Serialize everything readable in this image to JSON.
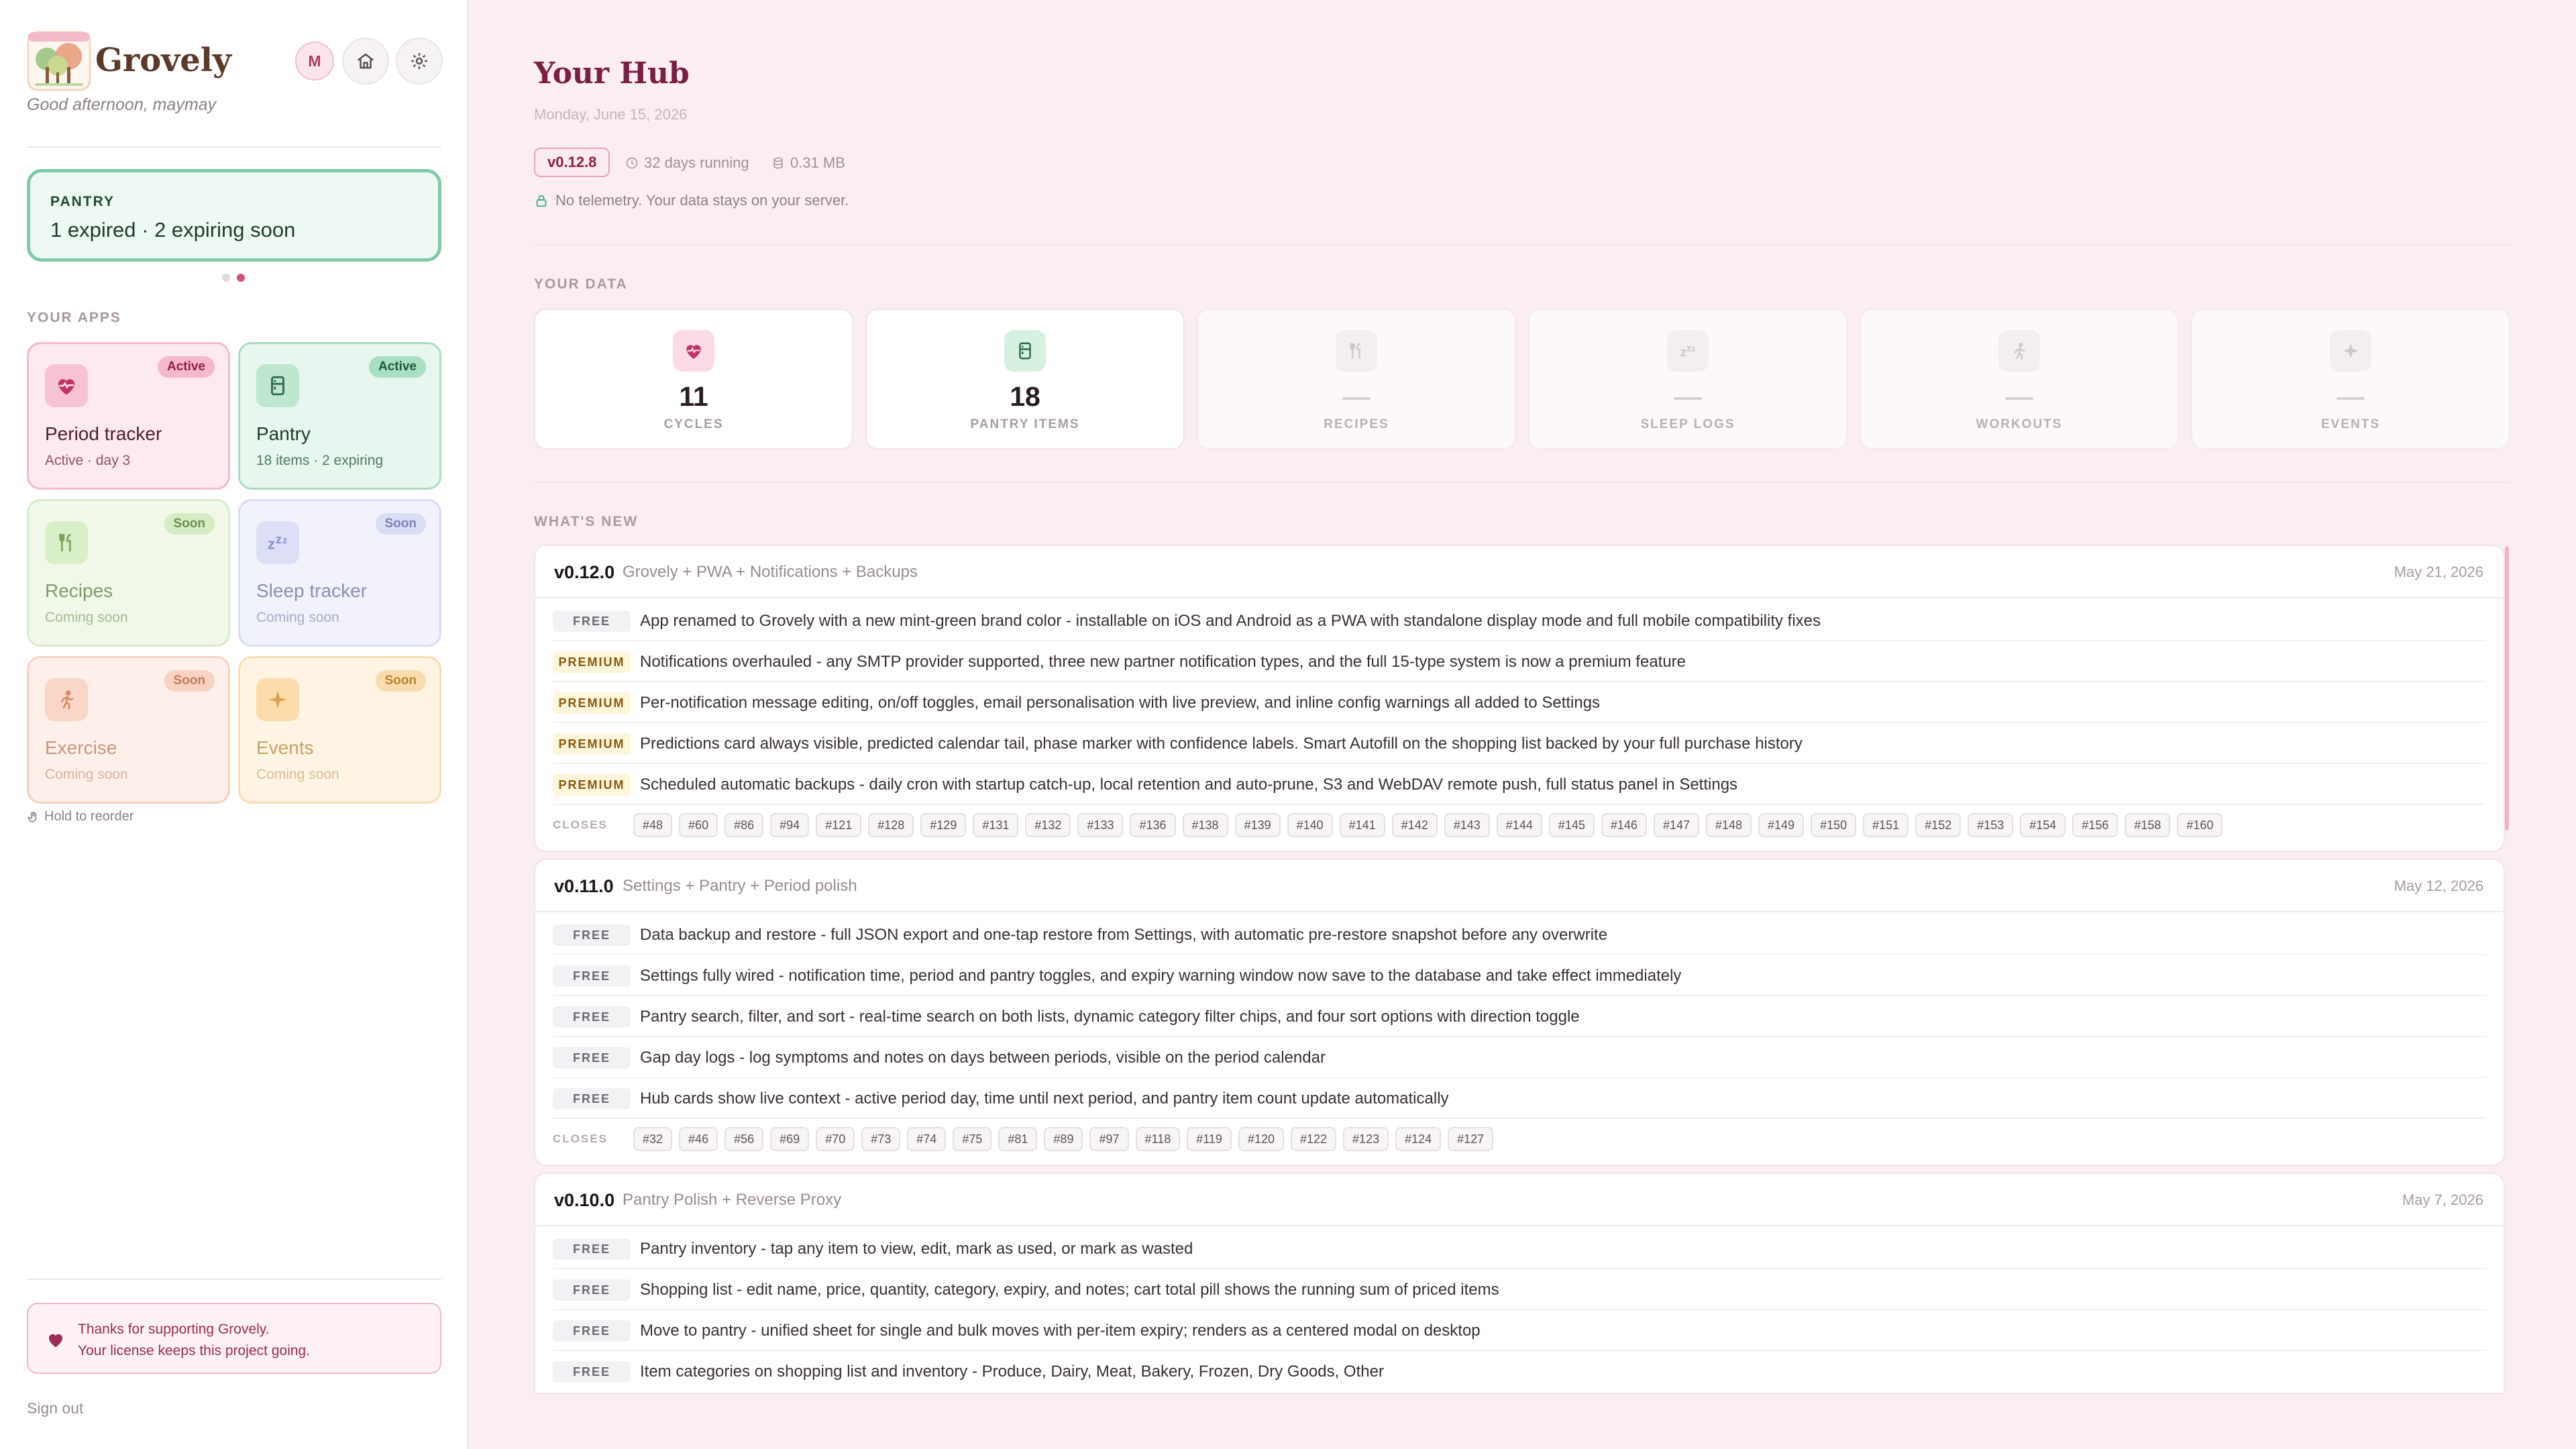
{
  "sidebar": {
    "brand": "Grovely",
    "greeting": "Good afternoon, maymay",
    "avatar_initial": "M",
    "alert": {
      "kicker": "PANTRY",
      "text": "1 expired · 2 expiring soon"
    },
    "apps_label": "YOUR APPS",
    "apps": [
      {
        "name": "Period tracker",
        "sub": "Active · day 3",
        "badge": "Active",
        "icon": "heart-pulse-icon"
      },
      {
        "name": "Pantry",
        "sub": "18 items · 2 expiring",
        "badge": "Active",
        "icon": "fridge-icon"
      },
      {
        "name": "Recipes",
        "sub": "Coming soon",
        "badge": "Soon",
        "icon": "utensils-icon"
      },
      {
        "name": "Sleep tracker",
        "sub": "Coming soon",
        "badge": "Soon",
        "icon": "zzz-icon"
      },
      {
        "name": "Exercise",
        "sub": "Coming soon",
        "badge": "Soon",
        "icon": "running-icon"
      },
      {
        "name": "Events",
        "sub": "Coming soon",
        "badge": "Soon",
        "icon": "sparkle-icon"
      }
    ],
    "hold_hint": "Hold to reorder",
    "thanks_line1": "Thanks for supporting Grovely.",
    "thanks_line2": "Your license keeps this project going.",
    "sign_out": "Sign out"
  },
  "header": {
    "title": "Your Hub",
    "date": "Monday, June 15, 2026",
    "version": "v0.12.8",
    "uptime": "32 days running",
    "size": "0.31 MB",
    "privacy": "No telemetry. Your data stays on your server."
  },
  "your_data": {
    "label": "YOUR DATA",
    "stats": [
      {
        "value": "11",
        "label": "CYCLES"
      },
      {
        "value": "18",
        "label": "PANTRY ITEMS"
      },
      {
        "value": "—",
        "label": "RECIPES"
      },
      {
        "value": "—",
        "label": "SLEEP LOGS"
      },
      {
        "value": "—",
        "label": "WORKOUTS"
      },
      {
        "value": "—",
        "label": "EVENTS"
      }
    ]
  },
  "whats_new": {
    "label": "WHAT'S NEW",
    "closes_label": "CLOSES",
    "releases": [
      {
        "version": "v0.12.0",
        "title": "Grovely + PWA + Notifications + Backups",
        "date": "May 21, 2026",
        "items": [
          {
            "tag": "FREE",
            "text": "App renamed to Grovely with a new mint-green brand color - installable on iOS and Android as a PWA with standalone display mode and full mobile compatibility fixes"
          },
          {
            "tag": "PREMIUM",
            "text": "Notifications overhauled - any SMTP provider supported, three new partner notification types, and the full 15-type system is now a premium feature"
          },
          {
            "tag": "PREMIUM",
            "text": "Per-notification message editing, on/off toggles, email personalisation with live preview, and inline config warnings all added to Settings"
          },
          {
            "tag": "PREMIUM",
            "text": "Predictions card always visible, predicted calendar tail, phase marker with confidence labels. Smart Autofill on the shopping list backed by your full purchase history"
          },
          {
            "tag": "PREMIUM",
            "text": "Scheduled automatic backups - daily cron with startup catch-up, local retention and auto-prune, S3 and WebDAV remote push, full status panel in Settings"
          }
        ],
        "closes": [
          "#48",
          "#60",
          "#86",
          "#94",
          "#121",
          "#128",
          "#129",
          "#131",
          "#132",
          "#133",
          "#136",
          "#138",
          "#139",
          "#140",
          "#141",
          "#142",
          "#143",
          "#144",
          "#145",
          "#146",
          "#147",
          "#148",
          "#149",
          "#150",
          "#151",
          "#152",
          "#153",
          "#154",
          "#156",
          "#158",
          "#160"
        ]
      },
      {
        "version": "v0.11.0",
        "title": "Settings + Pantry + Period polish",
        "date": "May 12, 2026",
        "items": [
          {
            "tag": "FREE",
            "text": "Data backup and restore - full JSON export and one-tap restore from Settings, with automatic pre-restore snapshot before any overwrite"
          },
          {
            "tag": "FREE",
            "text": "Settings fully wired - notification time, period and pantry toggles, and expiry warning window now save to the database and take effect immediately"
          },
          {
            "tag": "FREE",
            "text": "Pantry search, filter, and sort - real-time search on both lists, dynamic category filter chips, and four sort options with direction toggle"
          },
          {
            "tag": "FREE",
            "text": "Gap day logs - log symptoms and notes on days between periods, visible on the period calendar"
          },
          {
            "tag": "FREE",
            "text": "Hub cards show live context - active period day, time until next period, and pantry item count update automatically"
          }
        ],
        "closes": [
          "#32",
          "#46",
          "#56",
          "#69",
          "#70",
          "#73",
          "#74",
          "#75",
          "#81",
          "#89",
          "#97",
          "#118",
          "#119",
          "#120",
          "#122",
          "#123",
          "#124",
          "#127"
        ]
      },
      {
        "version": "v0.10.0",
        "title": "Pantry Polish + Reverse Proxy",
        "date": "May 7, 2026",
        "items": [
          {
            "tag": "FREE",
            "text": "Pantry inventory - tap any item to view, edit, mark as used, or mark as wasted"
          },
          {
            "tag": "FREE",
            "text": "Shopping list - edit name, price, quantity, category, expiry, and notes; cart total pill shows the running sum of priced items"
          },
          {
            "tag": "FREE",
            "text": "Move to pantry - unified sheet for single and bulk moves with per-item expiry; renders as a centered modal on desktop"
          },
          {
            "tag": "FREE",
            "text": "Item categories on shopping list and inventory - Produce, Dairy, Meat, Bakery, Frozen, Dry Goods, Other"
          }
        ],
        "closes": []
      }
    ]
  },
  "colors": {
    "brand": "#7a1f43",
    "accent_pink": "#d24c7c",
    "mint": "#7fcaa7",
    "background": "#fbeef3"
  }
}
